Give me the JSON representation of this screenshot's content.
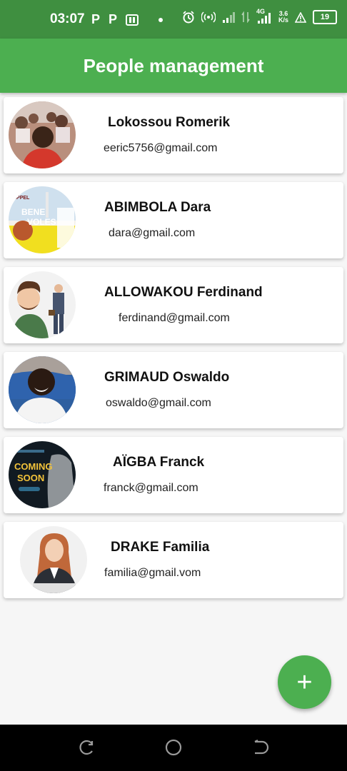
{
  "status_bar": {
    "time": "03:07",
    "left_icons": [
      "P",
      "P",
      "app-icon",
      "dot"
    ],
    "network_top": "4G",
    "speed_top": "3.6",
    "speed_unit": "K/s",
    "battery": "19"
  },
  "app_bar": {
    "title": "People management"
  },
  "people": [
    {
      "name": "Lokossou Romerik",
      "email": "eeric5756@gmail.com"
    },
    {
      "name": "ABIMBOLA Dara",
      "email": "dara@gmail.com"
    },
    {
      "name": "ALLOWAKOU Ferdinand",
      "email": "ferdinand@gmail.com"
    },
    {
      "name": "GRIMAUD Oswaldo",
      "email": "oswaldo@gmail.com"
    },
    {
      "name": "AÏGBA Franck",
      "email": "franck@gmail.com"
    },
    {
      "name": "DRAKE Familia",
      "email": "familia@gmail.vom"
    }
  ],
  "avatar_texts": {
    "poster_1": "APPEL",
    "poster_2": "BENE",
    "poster_3": "VOLES",
    "coming_1": "COMING",
    "coming_2": "SOON"
  },
  "fab": {
    "label": "+"
  },
  "colors": {
    "primary": "#4caf50",
    "status_bar": "#3f8f40"
  }
}
